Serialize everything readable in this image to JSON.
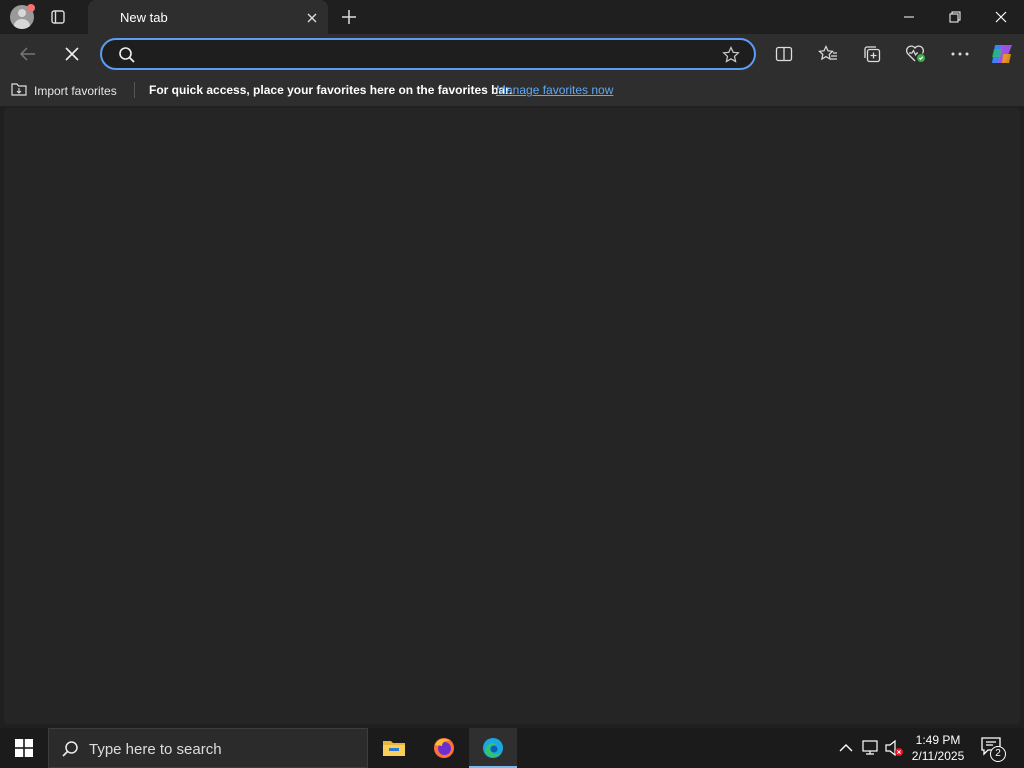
{
  "tab": {
    "title": "New tab"
  },
  "address_bar": {
    "value": "",
    "placeholder": ""
  },
  "favorites_bar": {
    "import_label": "Import favorites",
    "message": "For quick access, place your favorites here on the favorites bar.",
    "manage_link": "Manage favorites now"
  },
  "taskbar": {
    "search_placeholder": "Type here to search",
    "time": "1:49 PM",
    "date": "2/11/2025",
    "notification_count": "2"
  },
  "colors": {
    "accent": "#5e9bf2",
    "link": "#5fa8f5",
    "background": "#202020"
  },
  "icons": [
    "profile-icon",
    "tab-actions-icon",
    "close-icon",
    "plus-icon",
    "minimize-icon",
    "restore-icon",
    "back-arrow-icon",
    "stop-icon",
    "search-icon",
    "star-icon",
    "split-screen-icon",
    "favorites-icon",
    "collections-icon",
    "browser-essentials-icon",
    "more-icon",
    "copilot-icon",
    "import-icon",
    "windows-icon",
    "file-explorer-icon",
    "firefox-icon",
    "edge-icon",
    "chevron-up-icon",
    "network-icon",
    "volume-muted-icon",
    "notification-icon"
  ]
}
